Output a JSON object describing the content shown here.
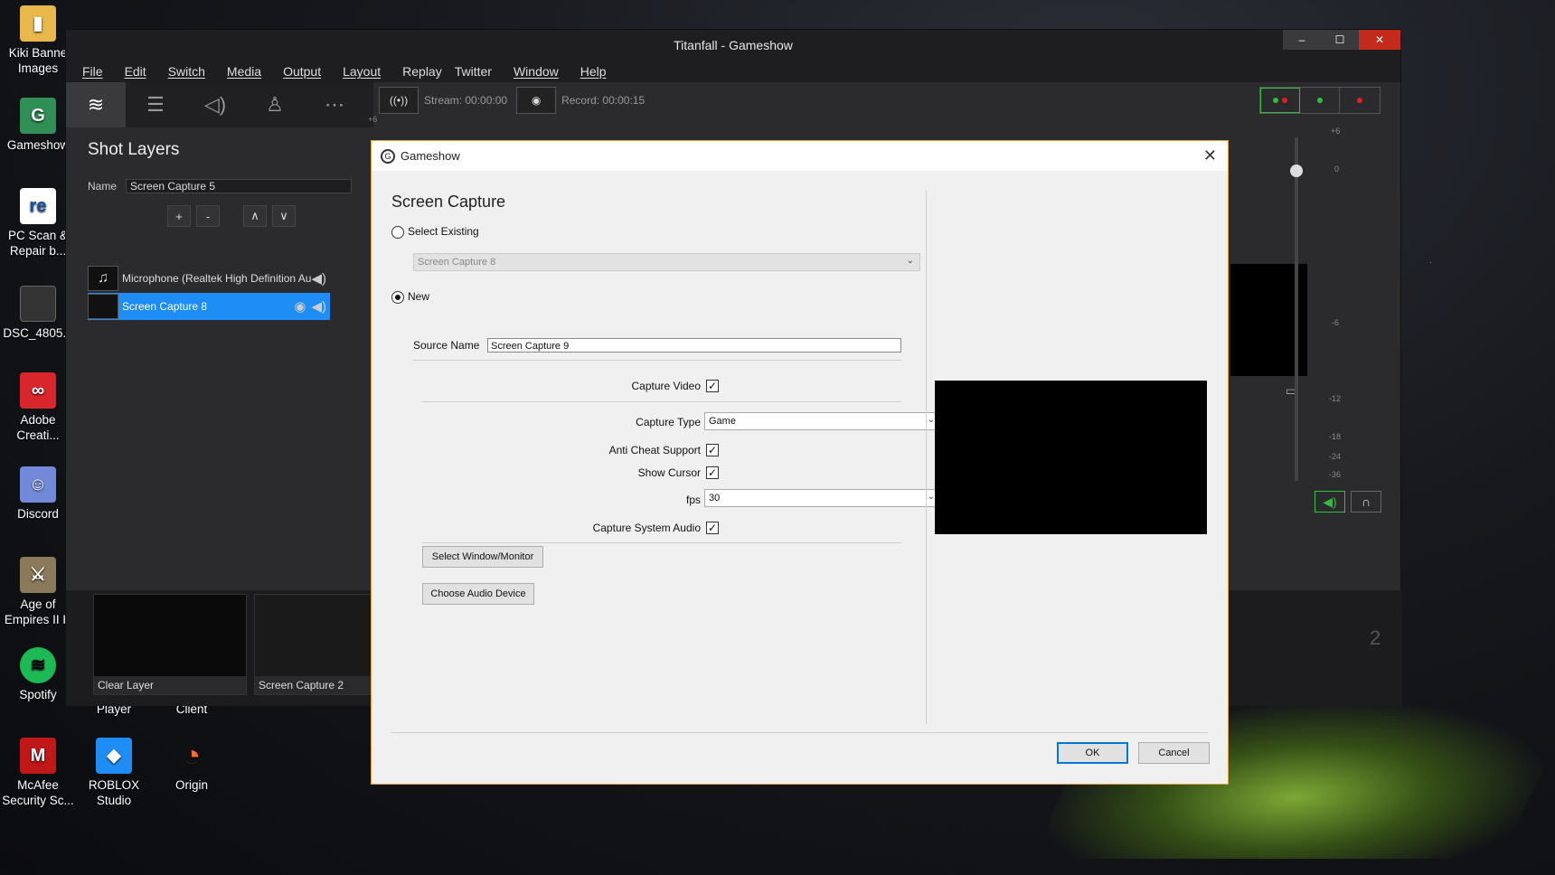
{
  "desktop": {
    "icons": [
      {
        "label": "Kiki Banne Images",
        "icon": "folder-icon",
        "color": "#e8b84a"
      },
      {
        "label": "Gameshow",
        "icon": "gameshow-icon",
        "color": "#2f8f55"
      },
      {
        "label": "PC Scan & Repair b...",
        "icon": "reimage-icon",
        "color": "#ffffff"
      },
      {
        "label": "DSC_4805.a",
        "icon": "video-file-icon",
        "color": "#333333"
      },
      {
        "label": "Adobe Creati...",
        "icon": "adobe-cc-icon",
        "color": "#d8262c"
      },
      {
        "label": "Discord",
        "icon": "discord-icon",
        "color": "#7289da"
      },
      {
        "label": "Age of Empires II H",
        "icon": "aoe-icon",
        "color": "#8a7a5a"
      },
      {
        "label": "Spotify",
        "icon": "spotify-icon",
        "color": "#1db954"
      },
      {
        "label": "McAfee Security Sc...",
        "icon": "mcafee-icon",
        "color": "#c01818"
      },
      {
        "label": "ROBLOX Studio",
        "icon": "roblox-icon",
        "color": "#1e8ef6"
      },
      {
        "label": "Origin",
        "icon": "origin-icon",
        "color": "#f56c2d"
      }
    ],
    "under_labels": {
      "player": "Player",
      "client": "Client"
    }
  },
  "app": {
    "title": "Titanfall - Gameshow",
    "menu": [
      "File",
      "Edit",
      "Switch",
      "Media",
      "Output",
      "Layout",
      "Replay",
      "Twitter",
      "Window",
      "Help"
    ],
    "panel_title": "Shot Layers",
    "name_label": "Name",
    "name_value": "Screen Capture 5",
    "layers": [
      {
        "label": "Microphone (Realtek High Definition Au"
      },
      {
        "label": "Screen Capture 8"
      }
    ],
    "stream_label": "Stream: 00:00:00",
    "record_label": "Record: 00:00:15",
    "meter_labels": [
      "+6",
      "0",
      "-6",
      "-12",
      "-18",
      "-24",
      "-36"
    ],
    "top_left_tick": "+6",
    "shots": [
      {
        "label": "Clear Layer"
      },
      {
        "label": "Screen Capture 2"
      }
    ],
    "shot_number": "2"
  },
  "dialog": {
    "title": "Gameshow",
    "heading": "Screen Capture",
    "select_existing_label": "Select Existing",
    "existing_value": "Screen Capture 8",
    "new_label": "New",
    "source_name_label": "Source Name",
    "source_name_value": "Screen Capture 9",
    "capture_video_label": "Capture Video",
    "capture_type_label": "Capture Type",
    "capture_type_value": "Game",
    "anti_cheat_label": "Anti Cheat Support",
    "show_cursor_label": "Show Cursor",
    "fps_label": "fps",
    "fps_value": "30",
    "capture_audio_label": "Capture System Audio",
    "select_window_btn": "Select Window/Monitor",
    "choose_audio_btn": "Choose Audio Device",
    "ok_btn": "OK",
    "cancel_btn": "Cancel"
  }
}
